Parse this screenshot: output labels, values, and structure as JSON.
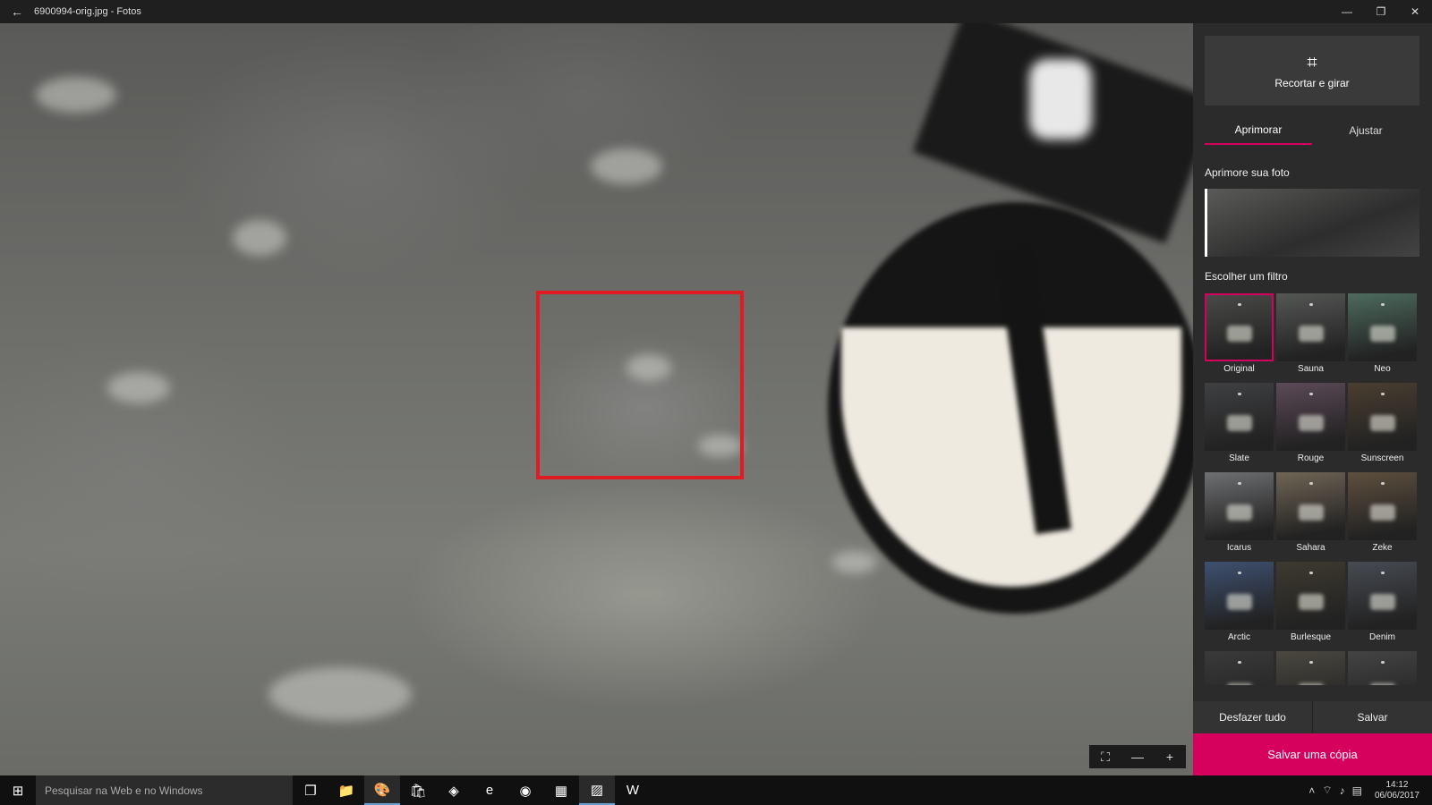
{
  "window": {
    "title": "6900994-orig.jpg - Fotos",
    "back_icon": "←",
    "minimize": "—",
    "maximize": "❐",
    "close": "✕"
  },
  "zoom": {
    "fit_icon": "⛶",
    "minus_icon": "—",
    "plus_icon": "+"
  },
  "panel": {
    "crop_label": "Recortar e girar",
    "crop_icon": "⌗",
    "tabs": [
      {
        "label": "Aprimorar"
      },
      {
        "label": "Ajustar"
      }
    ],
    "enhance_title": "Aprimore sua foto",
    "filter_title": "Escolher um filtro",
    "filters": [
      {
        "label": "Original",
        "color": "#4a4a48",
        "selected": true
      },
      {
        "label": "Sauna",
        "color": "#555755"
      },
      {
        "label": "Neo",
        "color": "#4d6b5e"
      },
      {
        "label": "Slate",
        "color": "#3f4042"
      },
      {
        "label": "Rouge",
        "color": "#5c4a58"
      },
      {
        "label": "Sunscreen",
        "color": "#4a3e30"
      },
      {
        "label": "Icarus",
        "color": "#6f7072"
      },
      {
        "label": "Sahara",
        "color": "#706555"
      },
      {
        "label": "Zeke",
        "color": "#5e4f3e"
      },
      {
        "label": "Arctic",
        "color": "#3e5070"
      },
      {
        "label": "Burlesque",
        "color": "#3e3a30"
      },
      {
        "label": "Denim",
        "color": "#474b52"
      },
      {
        "label": "",
        "color": "#3a3a3a"
      },
      {
        "label": "",
        "color": "#4a4840"
      },
      {
        "label": "",
        "color": "#444444"
      }
    ],
    "undo_label": "Desfazer tudo",
    "save_label": "Salvar",
    "save_copy_label": "Salvar uma cópia"
  },
  "taskbar": {
    "start_icon": "⊞",
    "search_placeholder": "Pesquisar na Web e no Windows",
    "apps": [
      {
        "name": "task-view-icon",
        "glyph": "❐"
      },
      {
        "name": "file-explorer-icon",
        "glyph": "📁"
      },
      {
        "name": "paint-icon",
        "glyph": "🎨",
        "active": true
      },
      {
        "name": "store-icon",
        "glyph": "🛍"
      },
      {
        "name": "app-icon",
        "glyph": "◈"
      },
      {
        "name": "edge-icon",
        "glyph": "e"
      },
      {
        "name": "chrome-icon",
        "glyph": "◉"
      },
      {
        "name": "calendar-icon",
        "glyph": "▦"
      },
      {
        "name": "photos-icon",
        "glyph": "▨",
        "active": true
      },
      {
        "name": "word-icon",
        "glyph": "W"
      }
    ],
    "time": "14:12",
    "date": "06/06/2017"
  }
}
